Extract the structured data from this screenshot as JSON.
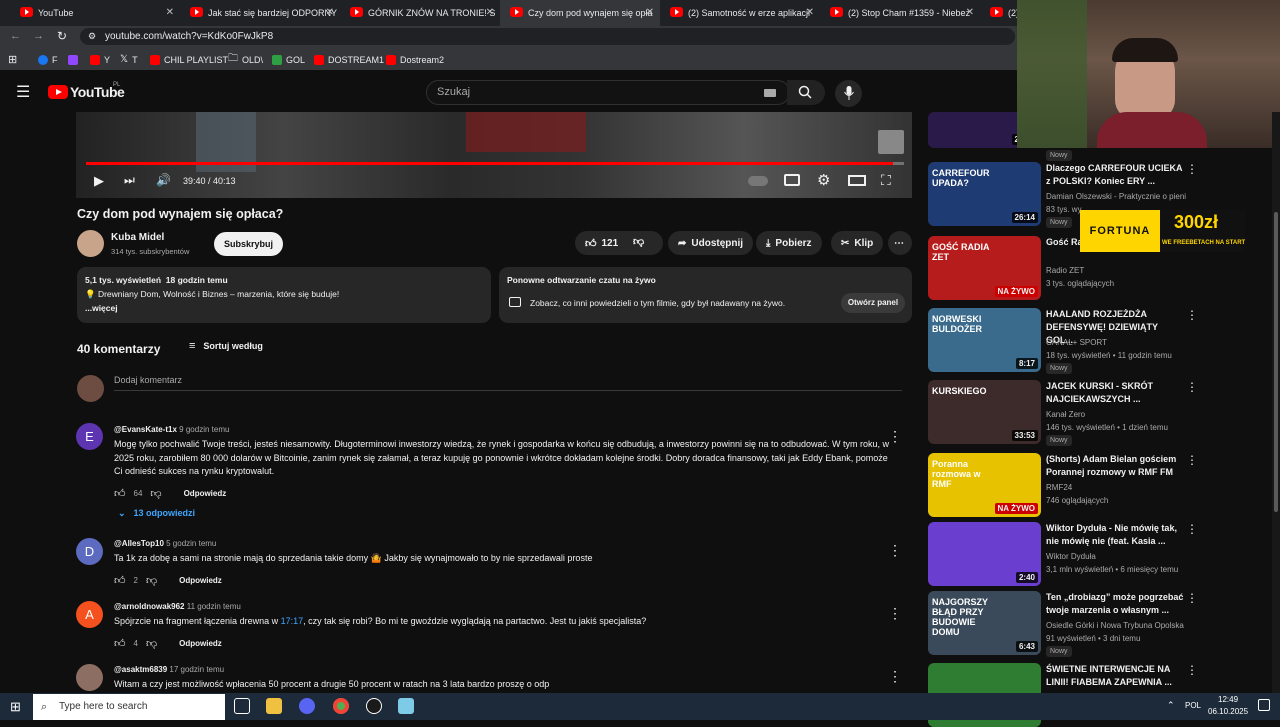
{
  "browser": {
    "tabs": [
      {
        "label": "YouTube"
      },
      {
        "label": "Jak stać się bardziej ODPORNY"
      },
      {
        "label": "GÓRNIK ZNÓW NA TRONIE! S"
      },
      {
        "label": "Czy dom pod wynajem się opła"
      },
      {
        "label": "(2) Samotność w erze aplikacji"
      },
      {
        "label": "(2) Stop Cham #1359 - Niebez"
      },
      {
        "label": "(2) M"
      }
    ],
    "url": "youtube.com/watch?v=KdKo0FwJkP8",
    "bookmarks": [
      "F",
      "Y",
      "T",
      "CHIL PLAYLIST",
      "OLD\\",
      "GOL",
      "DOSTREAM1",
      "Dostream2"
    ]
  },
  "youtube": {
    "logo": "YouTube",
    "logo_country": "PL",
    "search_placeholder": "Szukaj"
  },
  "player": {
    "time": "39:40 / 40:13",
    "progress": 0.986
  },
  "video": {
    "title": "Czy dom pod wynajem się opłaca?",
    "channel": "Kuba Midel",
    "subscribers": "314 tys. subskrybentów",
    "subscribe_label": "Subskrybuj",
    "likes": "121",
    "share_label": "Udostępnij",
    "download_label": "Pobierz",
    "clip_label": "Klip"
  },
  "description": {
    "stats": "5,1 tys. wyświetleń  18 godzin temu",
    "text": "💡 Drewniany Dom, Wolność i Biznes – marzenia, które się buduje!",
    "more": "...więcej"
  },
  "chat_replay": {
    "title": "Ponowne odtwarzanie czatu na żywo",
    "text": "Zobacz, co inni powiedzieli o tym filmie, gdy był nadawany na żywo.",
    "button": "Otwórz panel"
  },
  "comments": {
    "count_label": "40 komentarzy",
    "sort_label": "Sortuj według",
    "add_placeholder": "Dodaj komentarz",
    "reply_label": "Odpowiedz",
    "items": [
      {
        "initial": "E",
        "color": "#5e35b1",
        "author": "@EvansKate-t1x",
        "time": "9 godzin temu",
        "text": "Mogę tylko pochwalić Twoje treści, jesteś niesamowity. Długoterminowi inwestorzy wiedzą, że rynek i gospodarka w końcu się odbudują, a inwestorzy powinni się na to odbudować. W tym roku, w 2025 roku, zarobiłem 80 000 dolarów w Bitcoinie, zanim rynek się załamał, a teraz kupuję go ponownie i wkrótce dokładam kolejne środki. Dobry doradca finansowy, taki jak Eddy Ebank, pomoże Ci odnieść sukces na rynku kryptowalut.",
        "likes": "64",
        "replies": "13 odpowiedzi"
      },
      {
        "initial": "D",
        "color": "#5c6bc0",
        "author": "@AllesTop10",
        "time": "5 godzin temu",
        "text": "Ta 1k za dobę a sami na stronie mają do sprzedania takie domy 🤷 Jakby się wynajmowało to by nie sprzedawali proste",
        "likes": "2"
      },
      {
        "initial": "A",
        "color": "#f4511e",
        "author": "@arnoldnowak962",
        "time": "11 godzin temu",
        "text_pre": "Spójrzcie na fragment łączenia drewna w ",
        "timestamp": "17:17",
        "text_post": ", czy tak się robi? Bo mi te gwoździe wyglądają na partactwo. Jest tu jakiś specjalista?",
        "likes": "4"
      },
      {
        "initial": "",
        "color": "#8d6e63",
        "author": "@asaktm6839",
        "time": "17 godzin temu",
        "text": "Witam a czy jest możliwość wpłacenia 50 procent a drugie 50 procent w ratach na 3 lata bardzo proszę o odp"
      }
    ]
  },
  "recommendations": [
    {
      "title": "",
      "channel": "",
      "meta": "",
      "badge": "25:36",
      "new": "Nowy",
      "thumb": "#2a1a4a"
    },
    {
      "title": "Dlaczego CARREFOUR UCIEKA z POLSKI? Koniec ERY ...",
      "channel": "Damian Olszewski - Praktycznie o pienią...",
      "meta": "83 tys. wy",
      "badge": "26:14",
      "new": "Nowy",
      "thumb": "#1f3b73",
      "thumb_text": "CARREFOUR UPADA?"
    },
    {
      "title": "Gość Ra... Siemoniak",
      "channel": "Radio ZET",
      "meta": "3 tys. oglądających",
      "live": "NA ŻYWO",
      "thumb": "#b71c1c",
      "thumb_text": "GOŚĆ RADIA ZET"
    },
    {
      "title": "HAALAND ROZJEŻDŻA DEFENSYWĘ! DZIEWIĄTY GOL...",
      "channel": "CANAL+ SPORT",
      "meta": "18 tys. wyświetleń • 11 godzin temu",
      "badge": "8:17",
      "new": "Nowy",
      "thumb": "#3a6b8c",
      "thumb_text": "NORWESKI BULDOŻER"
    },
    {
      "title": "JACEK KURSKI - SKRÓT NAJCIEKAWSZYCH ...",
      "channel": "Kanał Zero",
      "meta": "146 tys. wyświetleń • 1 dzień temu",
      "badge": "33:53",
      "new": "Nowy",
      "thumb": "#3d2a2a",
      "thumb_text": "KURSKIEGO"
    },
    {
      "title": "(Shorts) Adam Bielan gościem Porannej rozmowy w RMF FM",
      "channel": "RMF24",
      "meta": "746 oglądających",
      "live": "NA ŻYWO",
      "thumb": "#e6c200",
      "thumb_text": "Poranna rozmowa w RMF"
    },
    {
      "title": "Wiktor Dyduła - Nie mówię tak, nie mówię nie (feat. Kasia ...",
      "channel": "Wiktor Dyduła",
      "meta": "3,1 mln wyświetleń • 6 miesięcy temu",
      "badge": "2:40",
      "thumb": "#6a3fd0"
    },
    {
      "title": "Ten „drobiazg” może pogrzebać twoje marzenia o własnym ...",
      "channel": "Osiedle Górki i Nowa Trybuna Opolska | ...",
      "meta": "91 wyświetleń • 3 dni temu",
      "badge": "6:43",
      "new": "Nowy",
      "thumb": "#3a4a5a",
      "thumb_text": "NAJGORSZY BŁĄD PRZY BUDOWIE DOMU"
    },
    {
      "title": "ŚWIETNE INTERWENCJE NA LINII! FIABEMA ZAPEWNIA ...",
      "channel": "",
      "meta": "",
      "thumb": "#2e7d32"
    }
  ],
  "ad": {
    "brand": "FORTUNA",
    "amount": "300zł",
    "sub": "WE FREEBETACH NA START"
  },
  "taskbar": {
    "search": "Type here to search",
    "lang": "POL",
    "time": "12:49",
    "date": "06.10.2025"
  },
  "colors": {
    "accent": "#ff0000",
    "link": "#3ea6ff"
  }
}
